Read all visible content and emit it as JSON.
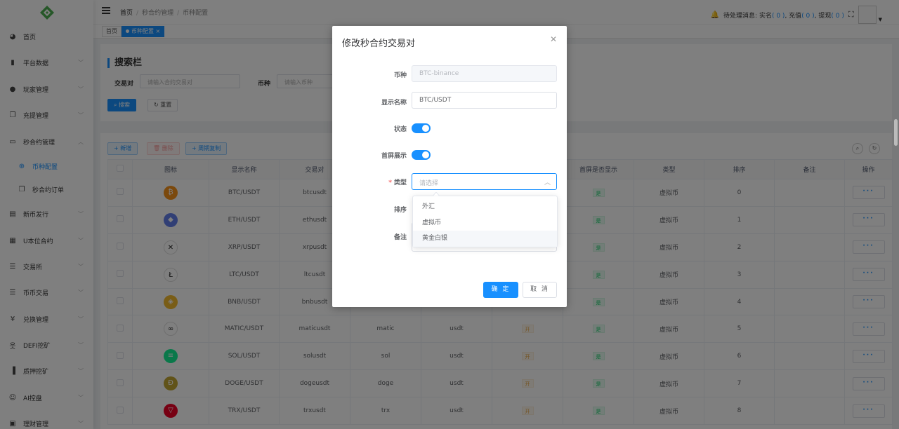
{
  "header": {
    "breadcrumb": [
      "首页",
      "秒合约管理",
      "币种配置"
    ],
    "notice_label": "待处理消息:",
    "notice_realname": "实名",
    "notice_realname_count": "( 0 )",
    "notice_recharge": "充值",
    "notice_recharge_count": "( 0 )",
    "notice_withdraw": "提现",
    "notice_withdraw_count": "( 0 )"
  },
  "tags": [
    "首页",
    "币种配置"
  ],
  "sidebar": {
    "items": [
      {
        "label": "首页",
        "icon": "dashboard-icon",
        "arrow": false
      },
      {
        "label": "平台数据",
        "icon": "book-icon",
        "arrow": true
      },
      {
        "label": "玩家管理",
        "icon": "user-icon",
        "arrow": true
      },
      {
        "label": "充提管理",
        "icon": "copy-icon",
        "arrow": true
      },
      {
        "label": "秒合约管理",
        "icon": "monitor-icon",
        "arrow": true,
        "expanded": true
      },
      {
        "label": "币种配置",
        "icon": "plus-circle-icon",
        "sub": true,
        "active": true
      },
      {
        "label": "秒合约订单",
        "icon": "copy-icon",
        "sub": true
      },
      {
        "label": "新币发行",
        "icon": "news-icon",
        "arrow": true
      },
      {
        "label": "U本位合约",
        "icon": "grid-icon",
        "arrow": true
      },
      {
        "label": "交易所",
        "icon": "list-icon",
        "arrow": true
      },
      {
        "label": "币币交易",
        "icon": "list-icon",
        "arrow": true
      },
      {
        "label": "兑换管理",
        "icon": "yen-icon",
        "arrow": true
      },
      {
        "label": "DEFI挖矿",
        "icon": "person-icon",
        "arrow": true
      },
      {
        "label": "质押挖矿",
        "icon": "bar-chart-icon",
        "arrow": true
      },
      {
        "label": "AI控盘",
        "icon": "robot-icon",
        "arrow": true
      },
      {
        "label": "理财管理",
        "icon": "wallet-icon",
        "arrow": true
      }
    ]
  },
  "search": {
    "title": "搜索栏",
    "pair_label": "交易对",
    "pair_placeholder": "请输入合约交易对",
    "coin_label": "币种",
    "coin_placeholder": "请输入币种",
    "search_btn": "搜索",
    "reset_btn": "重置"
  },
  "toolbar": {
    "add": "新增",
    "delete": "删除",
    "copy": "周期复制"
  },
  "table": {
    "headers": [
      "图标",
      "显示名称",
      "交易对",
      "",
      "",
      "",
      "首屏是否显示",
      "类型",
      "排序",
      "备注",
      "操作"
    ],
    "rows": [
      {
        "name": "BTC/USDT",
        "pair": "btcusdt",
        "coin": "",
        "base": "",
        "status": "",
        "show": "是",
        "type": "虚拟币",
        "sort": "0",
        "color": "#f7931a",
        "glyph": "₿"
      },
      {
        "name": "ETH/USDT",
        "pair": "ethusdt",
        "coin": "",
        "base": "",
        "status": "",
        "show": "是",
        "type": "虚拟币",
        "sort": "1",
        "color": "#627eea",
        "glyph": "◆"
      },
      {
        "name": "XRP/USDT",
        "pair": "xrpusdt",
        "coin": "",
        "base": "",
        "status": "",
        "show": "是",
        "type": "虚拟币",
        "sort": "2",
        "color": "#ffffff",
        "glyph": "✕"
      },
      {
        "name": "LTC/USDT",
        "pair": "ltcusdt",
        "coin": "",
        "base": "",
        "status": "",
        "show": "是",
        "type": "虚拟币",
        "sort": "3",
        "color": "#ffffff",
        "glyph": "Ł"
      },
      {
        "name": "BNB/USDT",
        "pair": "bnbusdt",
        "coin": "",
        "base": "",
        "status": "",
        "show": "是",
        "type": "虚拟币",
        "sort": "4",
        "color": "#f3ba2f",
        "glyph": "◈"
      },
      {
        "name": "MATIC/USDT",
        "pair": "maticusdt",
        "coin": "matic",
        "base": "usdt",
        "status": "开",
        "show": "是",
        "type": "虚拟币",
        "sort": "5",
        "color": "#ffffff",
        "glyph": "∞"
      },
      {
        "name": "SOL/USDT",
        "pair": "solusdt",
        "coin": "sol",
        "base": "usdt",
        "status": "开",
        "show": "是",
        "type": "虚拟币",
        "sort": "6",
        "color": "#14f195",
        "glyph": "≡"
      },
      {
        "name": "DOGE/USDT",
        "pair": "dogeusdt",
        "coin": "doge",
        "base": "usdt",
        "status": "开",
        "show": "是",
        "type": "虚拟币",
        "sort": "7",
        "color": "#c2a633",
        "glyph": "Ð"
      },
      {
        "name": "TRX/USDT",
        "pair": "trxusdt",
        "coin": "trx",
        "base": "usdt",
        "status": "开",
        "show": "是",
        "type": "虚拟币",
        "sort": "8",
        "color": "#ef0027",
        "glyph": "▽"
      }
    ]
  },
  "dialog": {
    "title": "修改秒合约交易对",
    "coin_label": "币种",
    "coin_value": "BTC-binance",
    "display_label": "显示名称",
    "display_value": "BTC/USDT",
    "status_label": "状态",
    "homepage_label": "首屏展示",
    "type_label": "类型",
    "type_placeholder": "请选择",
    "sort_label": "排序",
    "remark_label": "备注",
    "confirm": "确 定",
    "cancel": "取 消",
    "options": [
      "外汇",
      "虚拟币",
      "黄金白银"
    ]
  },
  "colors": {
    "accent": "#1890ff"
  }
}
